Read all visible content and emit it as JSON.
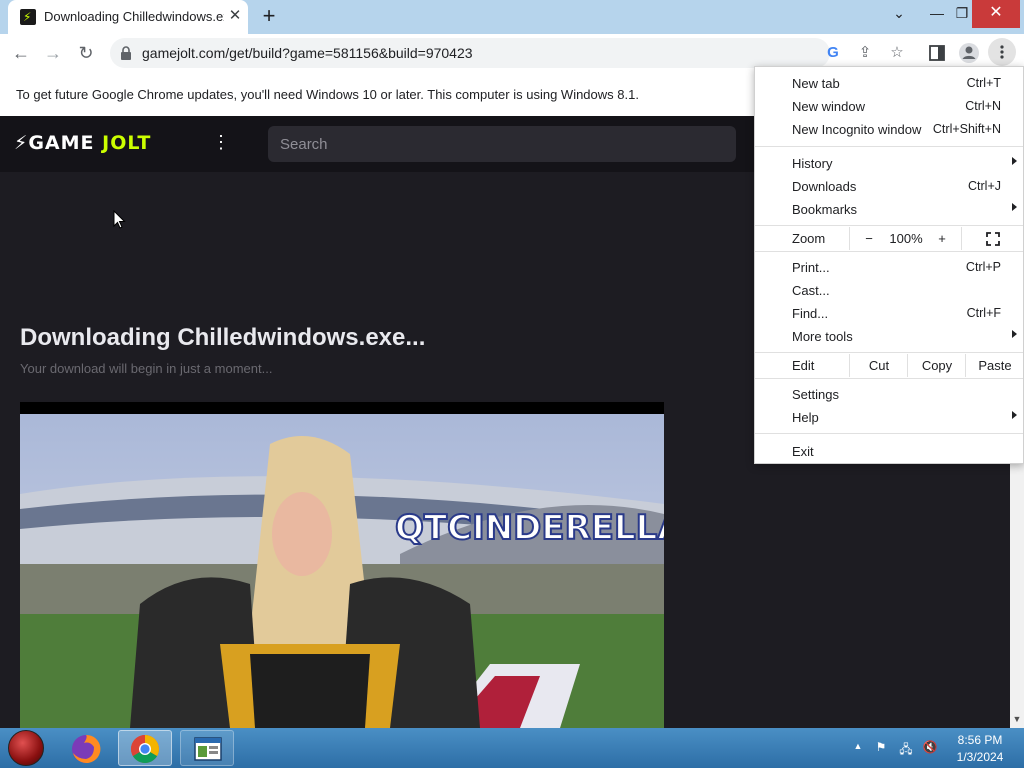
{
  "tab": {
    "title": "Downloading Chilledwindows.exe...",
    "close": "✕"
  },
  "newtab_label": "+",
  "window": {
    "tab_search": "⌄",
    "minimize": "—",
    "maximize": "❐",
    "close": "✕"
  },
  "toolbar": {
    "back": "←",
    "forward": "→",
    "reload": "↻",
    "url": "gamejolt.com/get/build?game=581156&build=970423"
  },
  "omnibox_icons": {
    "google": "G",
    "share": "⇪",
    "star": "☆"
  },
  "infobar": {
    "text": "To get future Google Chrome updates, you'll need Windows 10 or later. This computer is using Windows 8.1."
  },
  "gamejolt": {
    "logo_game": "⚡GAME",
    "logo_jolt": "JOLT",
    "more": "⋮",
    "search_placeholder": "Search",
    "download_title": "Downloading Chilledwindows.exe...",
    "download_subtitle": "Your download will begin in just a moment...",
    "video_caption": "QTCINDERELLA"
  },
  "menu": {
    "new_tab": {
      "label": "New tab",
      "shortcut": "Ctrl+T"
    },
    "new_window": {
      "label": "New window",
      "shortcut": "Ctrl+N"
    },
    "new_incognito": {
      "label": "New Incognito window",
      "shortcut": "Ctrl+Shift+N"
    },
    "history": {
      "label": "History"
    },
    "downloads": {
      "label": "Downloads",
      "shortcut": "Ctrl+J"
    },
    "bookmarks": {
      "label": "Bookmarks"
    },
    "zoom": {
      "label": "Zoom",
      "minus": "−",
      "value": "100%",
      "plus": "+"
    },
    "print": {
      "label": "Print...",
      "shortcut": "Ctrl+P"
    },
    "cast": {
      "label": "Cast..."
    },
    "find": {
      "label": "Find...",
      "shortcut": "Ctrl+F"
    },
    "more_tools": {
      "label": "More tools"
    },
    "edit": {
      "label": "Edit",
      "cut": "Cut",
      "copy": "Copy",
      "paste": "Paste"
    },
    "settings": {
      "label": "Settings"
    },
    "help": {
      "label": "Help"
    },
    "exit": {
      "label": "Exit"
    }
  },
  "taskbar": {
    "time": "8:56 PM",
    "date": "1/3/2024"
  },
  "colors": {
    "tabstrip": "#b6d4ec",
    "gamejolt_accent": "#ccff00",
    "page_bg": "#1d1c22",
    "close_red": "#c93a3a"
  }
}
